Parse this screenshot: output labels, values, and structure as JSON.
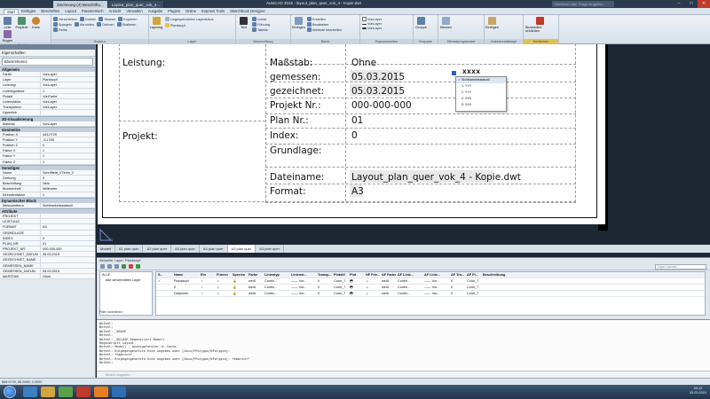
{
  "titlebar": {
    "doc_tabs": [
      "Zeichnung (4) Beschriftu...",
      "Layout_plan_quer_vok_4..."
    ],
    "app_title": "AutoCAD 2015 - layout_plan_quer_vok_4 - Kopie.dwt",
    "search_placeholder": "Stichwort oder Frage eingeben",
    "min": "–",
    "max": "□",
    "close": "✕"
  },
  "menu_tabs": [
    "Start",
    "Einfügen",
    "Beschriften",
    "Layout",
    "Parametrisch",
    "Ansicht",
    "Verwalten",
    "Ausgabe",
    "Plugins",
    "Online",
    "Express Tools",
    "Sketchbook Designer"
  ],
  "ribbon": {
    "panels": [
      {
        "title": "Zeichnen",
        "big": [
          "Linie",
          "Polylinie",
          "Kreis",
          "Bogen"
        ],
        "tools": []
      },
      {
        "title": "Ändern",
        "big": [],
        "tools": [
          "Verschieben",
          "Drehen",
          "Stutzen",
          "Kopieren",
          "Spiegeln",
          "Abrunden",
          "Dehnen",
          "Skalieren",
          "Reihe"
        ]
      },
      {
        "title": "Layer",
        "big": [
          "Layereig."
        ],
        "tools": [
          "Ungespeicherter Layerstatus",
          "Planksopf"
        ]
      },
      {
        "title": "Beschriftung",
        "big": [
          "Text",
          "Bemaßung"
        ],
        "tools": [
          "Linear",
          "Führung",
          "Tabelle"
        ]
      },
      {
        "title": "Block",
        "big": [
          "Einfügen"
        ],
        "tools": [
          "Erstellen",
          "Bearbeiten",
          "Attribute bearbeiten"
        ]
      },
      {
        "title": "Eigenschaften",
        "big": [],
        "tools": [
          "VonLayer",
          "VonLayer",
          "VonLayer"
        ]
      },
      {
        "title": "Gruppen",
        "big": [
          "Gruppe"
        ],
        "tools": []
      },
      {
        "title": "Dienstprogramme",
        "big": [
          "Messen"
        ],
        "tools": []
      },
      {
        "title": "Zwischenablage",
        "big": [
          "Einfügen"
        ],
        "tools": []
      },
      {
        "title": "Schließen",
        "big": [
          "Blockeditor schließen"
        ],
        "tools": []
      }
    ]
  },
  "properties": {
    "header": "Eigenschaften",
    "selection": "Blockreferenz",
    "sections": [
      {
        "name": "Allgemein",
        "rows": [
          [
            "Farbe",
            "VonLayer"
          ],
          [
            "Layer",
            "Planksopf"
          ],
          [
            "Linientyp",
            "VonLayer"
          ],
          [
            "Linientypfaktor",
            "1"
          ],
          [
            "Plotstil",
            "VonFarbe"
          ],
          [
            "Linienstärke",
            "VonLayer"
          ],
          [
            "Transparenz",
            "VonLayer"
          ],
          [
            "Hyperlink",
            ""
          ]
        ]
      },
      {
        "name": "3D-Visualisierung",
        "rows": [
          [
            "Material",
            "VonLayer"
          ]
        ]
      },
      {
        "name": "Geometrie",
        "rows": [
          [
            "Position X",
            "443.0729"
          ],
          [
            "Position Y",
            "-3.1765"
          ],
          [
            "Position Z",
            "0"
          ],
          [
            "Faktor X",
            "1"
          ],
          [
            "Faktor Y",
            "1"
          ],
          [
            "Faktor Z",
            "1"
          ]
        ]
      },
      {
        "name": "Sonstiges",
        "rows": [
          [
            "Name",
            "Schriftfeld_V7lmm_2"
          ],
          [
            "Drehung",
            "0"
          ],
          [
            "Beschriftung",
            "Nein"
          ],
          [
            "Blockeinheit",
            "Millimeter"
          ],
          [
            "Einheitenfaktor",
            "1"
          ]
        ]
      },
      {
        "name": "Dynamischer Block",
        "rows": [
          [
            "Messwertform",
            "Sichtbarkeitsstatus0"
          ]
        ]
      },
      {
        "name": "Attribute",
        "rows": [
          [
            "PROJEKT",
            ""
          ],
          [
            "LEISTUNG",
            ""
          ],
          [
            "FORMAT",
            "A3"
          ],
          [
            "GRUNDLAGE",
            ""
          ],
          [
            "INDEX",
            "0"
          ],
          [
            "PLAN_NR",
            "01"
          ],
          [
            "PROJEKT_NR",
            "000-000-000"
          ],
          [
            "GEZEICHNET_DATUM",
            "05.03.2015"
          ],
          [
            "GEZEICHNET_NAME",
            ""
          ],
          [
            "GEMESSEN_NAME",
            ""
          ],
          [
            "GEMESSEN_DATUM",
            "05.03.2015"
          ],
          [
            "MASSTAB",
            "Ohne"
          ]
        ]
      }
    ]
  },
  "titleblock": {
    "leistung_label": "Leistung:",
    "projekt_label": "Projekt:",
    "massstab_label": "Maßstab:",
    "massstab_value": "Ohne",
    "gemessen_label": "gemessen:",
    "gemessen_value": "05.03.2015",
    "gezeichnet_label": "gezeichnet:",
    "gezeichnet_value": "05.03.2015",
    "projekt_nr_label": "Projekt Nr.:",
    "projekt_nr_value": "000-000-000",
    "plan_nr_label": "Plan Nr.:",
    "plan_nr_value": "01",
    "index_label": "Index:",
    "index_value": "0",
    "grundlage_label": "Grundlage:",
    "dateiname_label": "Dateiname:",
    "dateiname_value": "Layout_plan_quer_vok_4 - Kopie.dwt",
    "format_label": "Format:",
    "format_value": "A3",
    "grip_label": "XXXX"
  },
  "popup": {
    "items": [
      "Sichtbarkeitsstatus0",
      "1. YYY",
      "2. YYY",
      "4. XXX",
      "5. XXX"
    ]
  },
  "layout_tabs": [
    "Modell",
    "A1 plan quer",
    "A2 plan quer",
    "A3 plan quer",
    "A4 plan quer",
    "A3 plan quer",
    "A3 plan quer"
  ],
  "layers": {
    "title": "Aktueller Layer: Planksopf",
    "search_placeholder": "Layer suchen",
    "tree": [
      "ALLE",
      "Alle verwendeten Layer"
    ],
    "filter_toggle": "Filter invertieren",
    "columns": [
      "S..",
      "Name",
      "Ein",
      "Frieren",
      "Sperren",
      "Farbe",
      "Linientyp",
      "Linienst...",
      "Transp...",
      "Plotstil",
      "Plot",
      "NF Frie...",
      "AF Farbe",
      "AF Linie...",
      "AF Linie...",
      "AF Tra...",
      "AF Pl...",
      "Beschreibung"
    ],
    "rows": [
      [
        "✓",
        "Planksopf",
        "♀",
        "☼",
        "🔓",
        "weiß",
        "Contin...",
        "—— Vor...",
        "0",
        "Color_7",
        "🖶",
        "☼",
        "weiß",
        "Contin...",
        "—— Vor...",
        "0",
        "Color_7",
        ""
      ],
      [
        "",
        "0",
        "♀",
        "☼",
        "🔓",
        "weiß",
        "Contin...",
        "—— Vor...",
        "0",
        "Color_7",
        "🖶",
        "☼",
        "weiß",
        "Contin...",
        "—— Vor...",
        "0",
        "Color_7",
        ""
      ],
      [
        "",
        "Defpoints",
        "♀",
        "☼",
        "🔓",
        "weiß",
        "Contin...",
        "—— Vor...",
        "0",
        "Color_7",
        "🖶",
        "☼",
        "weiß",
        "Contin...",
        "—— Vor...",
        "0",
        "Color_7",
        ""
      ]
    ],
    "status": "ALLE: 4 Layer angezeigt von 4 Gesamtlayern"
  },
  "command": {
    "lines": [
      "Befehl:",
      "Befehl:",
      "Befehl: _BSAVE",
      "Befehl:",
      "Befehl: _BCLOSE Regeneriert Modell.",
      "Regeneriert Layout.",
      "Befehl: Modell - Anzeigefenster in Cache.",
      "Befehl: Entgegengesetzte Ecke angeben oder [Zaun/FPolygon/KPolygon]:",
      "Befehl: *Abbruch*",
      "Befehl: Entgegengesetzte Ecke angeben oder [Zaun/FPolygon/KPolygon]: *Abbruch*",
      "Befehl:"
    ],
    "input_placeholder": "Befehl eingeben"
  },
  "status": {
    "coords": "868.9720, 56.2565, 0.0000"
  },
  "taskbar": {
    "time": "09:12",
    "date": "05.03.2015"
  },
  "colors": {
    "accent": "#2b3a4d",
    "sheet": "#ffffff",
    "canvas": "#1e2633",
    "close": "#c13a2c"
  }
}
